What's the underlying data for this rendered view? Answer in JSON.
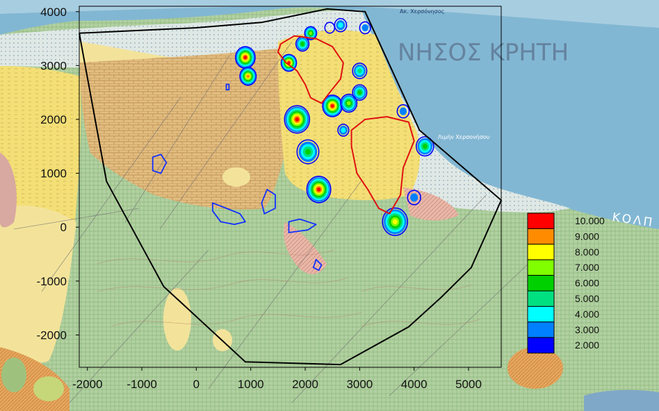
{
  "map": {
    "place_labels": {
      "island": "ΝΗΣΟΣ ΚΡΗΤΗ",
      "gulf": "ΚΟΛΠ",
      "harbor": "Λιμήν Χερσονήσου",
      "cape": "Ακ. Χερσόνησος"
    },
    "colors": {
      "sea": "#7eb6d4",
      "sea_light": "#a9cfe0",
      "limestone_yellow": "#f2de73",
      "brick_tan": "#d9b479",
      "green_hatch": "#a9c99a",
      "pale_green": "#c9dfb4",
      "pink": "#e9b3a3",
      "frame": "#000000"
    }
  },
  "chart_data": {
    "type": "contour",
    "x_ticks": [
      "-2000",
      "-1000",
      "0",
      "1000",
      "2000",
      "3000",
      "4000",
      "5000"
    ],
    "y_ticks": [
      "4000",
      "3000",
      "2000",
      "1000",
      "0",
      "-1000",
      "-2000"
    ],
    "x_tick_values": [
      -2000,
      -1000,
      0,
      1000,
      2000,
      3000,
      4000,
      5000
    ],
    "y_tick_values": [
      4000,
      3000,
      2000,
      1000,
      0,
      -1000,
      -2000
    ],
    "xlim": [
      -2150,
      5600
    ],
    "ylim": [
      -2600,
      4100
    ],
    "grid": false,
    "legend": {
      "placement": "right",
      "levels": [
        {
          "label": "10.000",
          "color": "#ff0000"
        },
        {
          "label": "9.000",
          "color": "#ff8c00"
        },
        {
          "label": "8.000",
          "color": "#ffff00"
        },
        {
          "label": "7.000",
          "color": "#80ff00"
        },
        {
          "label": "6.000",
          "color": "#00d000"
        },
        {
          "label": "5.000",
          "color": "#00e080"
        },
        {
          "label": "4.000",
          "color": "#00ffff"
        },
        {
          "label": "3.000",
          "color": "#0080ff"
        },
        {
          "label": "2.000",
          "color": "#0000ff"
        }
      ]
    },
    "boundary": [
      [
        -2150,
        3600
      ],
      [
        -1650,
        850
      ],
      [
        -600,
        -1100
      ],
      [
        900,
        -2500
      ],
      [
        2650,
        -2550
      ],
      [
        3900,
        -1850
      ],
      [
        4500,
        -1300
      ],
      [
        5050,
        -750
      ],
      [
        5600,
        500
      ],
      [
        4100,
        1800
      ],
      [
        3100,
        4000
      ],
      [
        2400,
        4050
      ],
      [
        1200,
        3800
      ],
      [
        0,
        3700
      ],
      [
        -2150,
        3600
      ]
    ],
    "red_contours": [
      [
        [
          1550,
          3400
        ],
        [
          1800,
          3550
        ],
        [
          2200,
          3500
        ],
        [
          2500,
          3350
        ],
        [
          2700,
          3050
        ],
        [
          2650,
          2750
        ],
        [
          2450,
          2500
        ],
        [
          2300,
          2300
        ],
        [
          2100,
          2400
        ],
        [
          2000,
          2650
        ],
        [
          1850,
          2900
        ],
        [
          1650,
          3050
        ],
        [
          1500,
          3250
        ],
        [
          1550,
          3400
        ]
      ],
      [
        [
          3100,
          2000
        ],
        [
          3500,
          2050
        ],
        [
          3900,
          1950
        ],
        [
          4000,
          1600
        ],
        [
          3800,
          1100
        ],
        [
          3750,
          600
        ],
        [
          3550,
          250
        ],
        [
          3350,
          350
        ],
        [
          3150,
          700
        ],
        [
          2950,
          1000
        ],
        [
          2850,
          1500
        ],
        [
          2850,
          1800
        ],
        [
          3100,
          2000
        ]
      ]
    ],
    "anomalies": [
      {
        "x": 1850,
        "y": 2000,
        "r": 230,
        "peak": 10
      },
      {
        "x": 2050,
        "y": 1400,
        "r": 200,
        "peak": 6
      },
      {
        "x": 2250,
        "y": 700,
        "r": 220,
        "peak": 10
      },
      {
        "x": 2500,
        "y": 2250,
        "r": 180,
        "peak": 10
      },
      {
        "x": 2800,
        "y": 2300,
        "r": 150,
        "peak": 7
      },
      {
        "x": 3000,
        "y": 2500,
        "r": 130,
        "peak": 6
      },
      {
        "x": 3000,
        "y": 2900,
        "r": 130,
        "peak": 5
      },
      {
        "x": 900,
        "y": 3150,
        "r": 180,
        "peak": 10
      },
      {
        "x": 950,
        "y": 2800,
        "r": 150,
        "peak": 9
      },
      {
        "x": 1700,
        "y": 3050,
        "r": 140,
        "peak": 10
      },
      {
        "x": 1950,
        "y": 3400,
        "r": 120,
        "peak": 6
      },
      {
        "x": 2100,
        "y": 3600,
        "r": 110,
        "peak": 7
      },
      {
        "x": 2650,
        "y": 3750,
        "r": 110,
        "peak": 4
      },
      {
        "x": 3100,
        "y": 3700,
        "r": 100,
        "peak": 3
      },
      {
        "x": 2450,
        "y": 3700,
        "r": 90,
        "peak": 2
      },
      {
        "x": 2700,
        "y": 1800,
        "r": 100,
        "peak": 4
      },
      {
        "x": 4200,
        "y": 1500,
        "r": 160,
        "peak": 6
      },
      {
        "x": 3800,
        "y": 2150,
        "r": 110,
        "peak": 3
      },
      {
        "x": 3650,
        "y": 100,
        "r": 230,
        "peak": 8
      },
      {
        "x": 4000,
        "y": 550,
        "r": 120,
        "peak": 3
      }
    ],
    "blue_outlines": [
      [
        [
          -800,
          1300
        ],
        [
          -650,
          1350
        ],
        [
          -550,
          1200
        ],
        [
          -650,
          1000
        ],
        [
          -800,
          1050
        ],
        [
          -800,
          1300
        ]
      ],
      [
        [
          300,
          450
        ],
        [
          550,
          350
        ],
        [
          800,
          250
        ],
        [
          900,
          100
        ],
        [
          700,
          50
        ],
        [
          450,
          100
        ],
        [
          300,
          300
        ],
        [
          300,
          450
        ]
      ],
      [
        [
          1300,
          700
        ],
        [
          1450,
          600
        ],
        [
          1450,
          350
        ],
        [
          1250,
          250
        ],
        [
          1200,
          450
        ],
        [
          1300,
          700
        ]
      ],
      [
        [
          1700,
          100
        ],
        [
          1900,
          150
        ],
        [
          2200,
          50
        ],
        [
          2050,
          -50
        ],
        [
          1700,
          -100
        ],
        [
          1700,
          100
        ]
      ],
      [
        [
          2200,
          -600
        ],
        [
          2300,
          -700
        ],
        [
          2250,
          -800
        ],
        [
          2150,
          -750
        ],
        [
          2200,
          -600
        ]
      ],
      [
        [
          550,
          2650
        ],
        [
          600,
          2650
        ],
        [
          600,
          2550
        ],
        [
          550,
          2550
        ],
        [
          550,
          2650
        ]
      ]
    ]
  }
}
